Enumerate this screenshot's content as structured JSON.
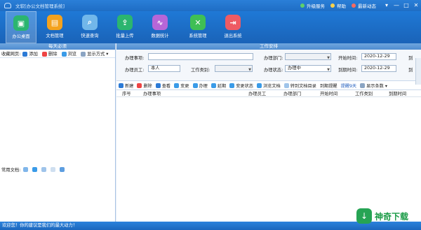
{
  "app": {
    "title": "文软[办公文档管理系统]",
    "links": [
      {
        "label": "升级服务",
        "color": "#5fd06a"
      },
      {
        "label": "帮助",
        "color": "#ffd24a"
      },
      {
        "label": "最新动态",
        "color": "#ff6a5f"
      }
    ],
    "window_buttons": [
      "▾",
      "—",
      "□",
      "✕"
    ]
  },
  "toolbar": [
    {
      "label": "办公桌面",
      "glyph": "▣",
      "color": "#2bb56f"
    },
    {
      "label": "文档管理",
      "glyph": "▤",
      "color": "#f4a21d"
    },
    {
      "label": "快速查询",
      "glyph": "⌕",
      "color": "#71b7ea"
    },
    {
      "label": "批量上传",
      "glyph": "⇪",
      "color": "#2bb56f"
    },
    {
      "label": "数据统计",
      "glyph": "∿",
      "color": "#b666d8"
    },
    {
      "label": "系统管理",
      "glyph": "✕",
      "color": "#3fbf54"
    },
    {
      "label": "退出系统",
      "glyph": "⇥",
      "color": "#ee5b63"
    }
  ],
  "left": {
    "header": "每天必须",
    "toolbar": [
      "收藏网页:",
      "添加",
      "删除",
      "浏览",
      "显示方式 ▾"
    ],
    "common_docs": "常用文档:"
  },
  "right": {
    "header": "工作安排",
    "labels": {
      "item": "办理事项:",
      "staff": "办理员工:",
      "category": "工作类别:",
      "dept": "办理部门:",
      "status": "办理状态:",
      "start": "开始时间:",
      "end": "到期时间:",
      "end_short": "到"
    },
    "values": {
      "staff": "本人",
      "status": "办理中",
      "date1": "2020-12-29",
      "date2": "2020-12-29",
      "start_short": "到"
    },
    "actions": [
      "新建",
      "删除",
      "查看",
      "变更",
      "办理",
      "延期",
      "变更状态",
      "浏览文档",
      "转到文档目录",
      "到期提醒",
      "提醒9天",
      "显示条数 ▾"
    ],
    "columns": [
      "序号",
      "办理事项",
      "办理员工",
      "办理部门",
      "开始时间",
      "工作类别",
      "到期时间"
    ]
  },
  "status": "欢迎您！你的建议是我们的最大动力！",
  "watermark": "神奇下载"
}
